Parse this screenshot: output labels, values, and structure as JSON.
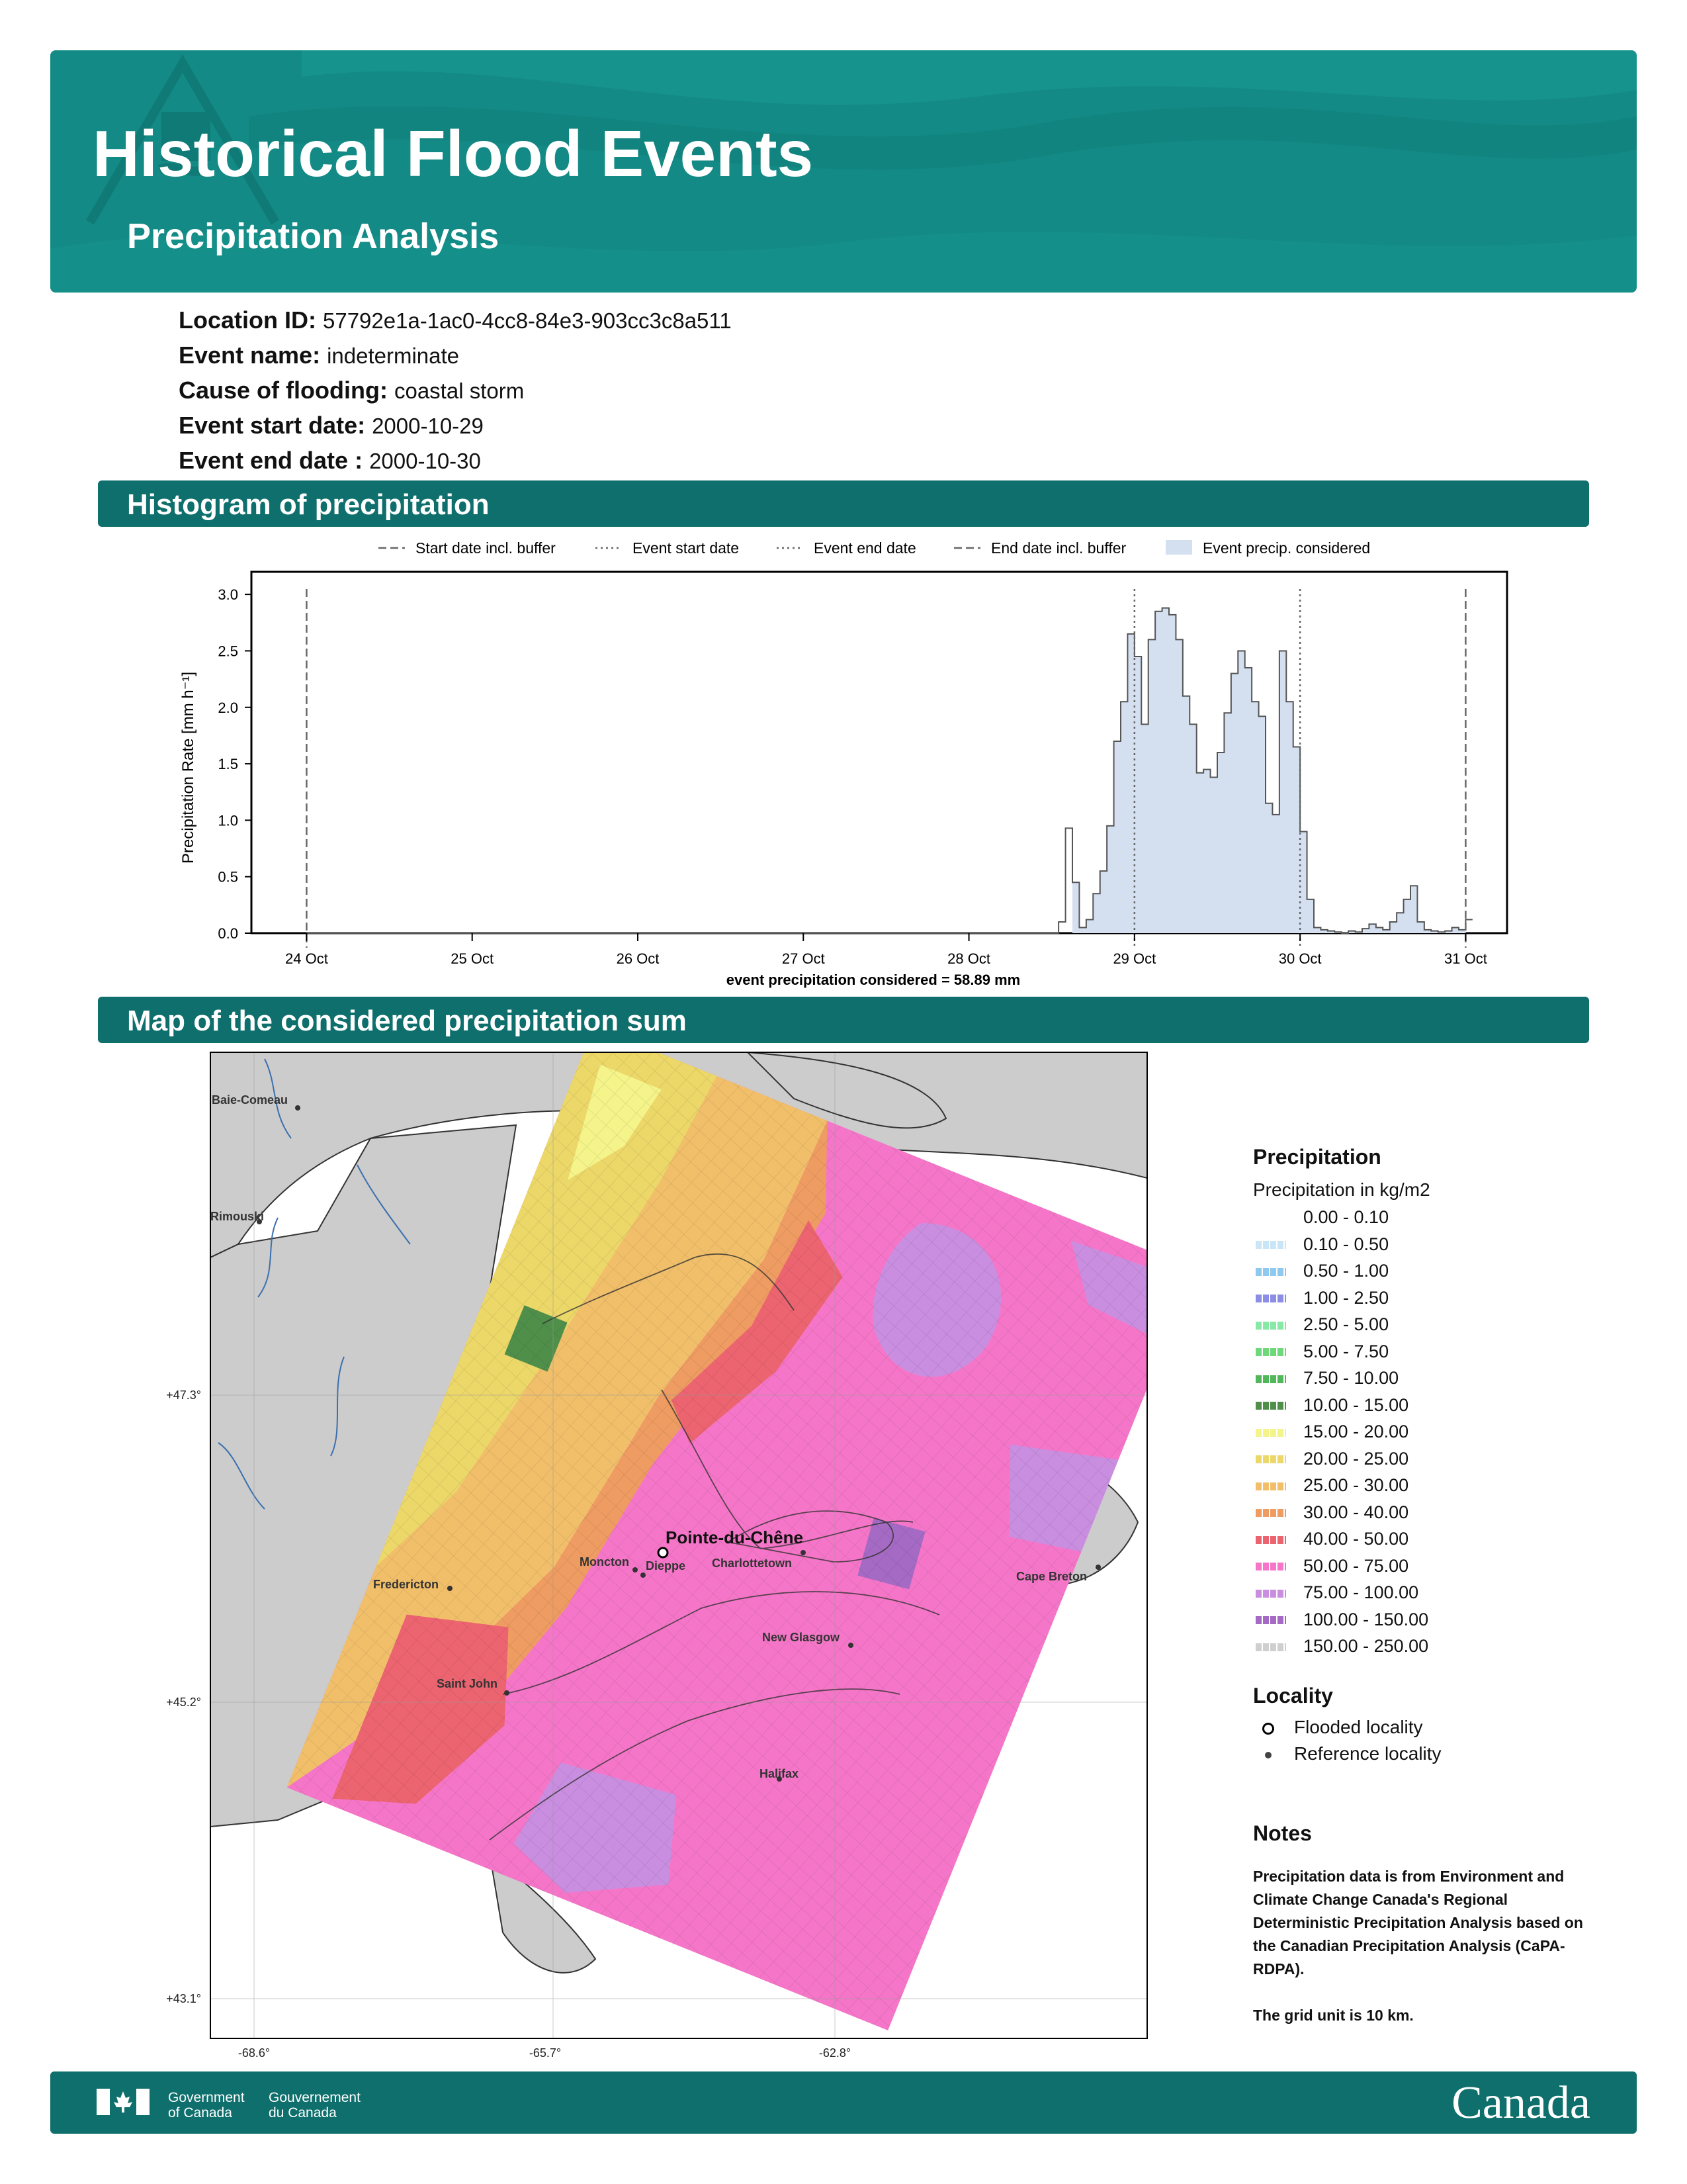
{
  "header": {
    "title": "Historical Flood Events",
    "subtitle": "Precipitation Analysis"
  },
  "meta": [
    {
      "label": "Location ID:",
      "value": "57792e1a-1ac0-4cc8-84e3-903cc3c8a511"
    },
    {
      "label": "Event name:",
      "value": "indeterminate"
    },
    {
      "label": "Cause of flooding:",
      "value": "coastal storm"
    },
    {
      "label": "Event start date:",
      "value": "2000-10-29"
    },
    {
      "label": "Event end date :",
      "value": "2000-10-30"
    }
  ],
  "sections": {
    "histogram": "Histogram of precipitation",
    "map": "Map of the considered precipitation sum"
  },
  "chart_data": {
    "type": "area",
    "ylabel": "Precipitation Rate [mm h⁻¹]",
    "xlabel": "event precipitation considered = 58.89 mm",
    "ylim": [
      0,
      3.2
    ],
    "xlim": [
      "2000-10-23T16:00",
      "2000-10-31T06:00"
    ],
    "x_ticks": [
      {
        "date": "2000-10-24",
        "label": "24 Oct"
      },
      {
        "date": "2000-10-25",
        "label": "25 Oct"
      },
      {
        "date": "2000-10-26",
        "label": "26 Oct"
      },
      {
        "date": "2000-10-27",
        "label": "27 Oct"
      },
      {
        "date": "2000-10-28",
        "label": "28 Oct"
      },
      {
        "date": "2000-10-29",
        "label": "29 Oct"
      },
      {
        "date": "2000-10-30",
        "label": "30 Oct"
      },
      {
        "date": "2000-10-31",
        "label": "31 Oct"
      }
    ],
    "y_ticks": [
      {
        "value": 0.0,
        "label": "0.0"
      },
      {
        "value": 0.5,
        "label": "0.5"
      },
      {
        "value": 1.0,
        "label": "1.0"
      },
      {
        "value": 1.5,
        "label": "1.5"
      },
      {
        "value": 2.0,
        "label": "2.0"
      },
      {
        "value": 2.5,
        "label": "2.5"
      },
      {
        "value": 3.0,
        "label": "3.0"
      }
    ],
    "legend": [
      {
        "label": "Start date incl. buffer",
        "style": "dashed"
      },
      {
        "label": "Event start date",
        "style": "dotted"
      },
      {
        "label": "Event end date",
        "style": "dotted"
      },
      {
        "label": "End date incl. buffer",
        "style": "dashed"
      },
      {
        "label": "Event precip. considered",
        "style": "fill"
      }
    ],
    "vlines": [
      {
        "date": "2000-10-24T00:00",
        "style": "dashed"
      },
      {
        "date": "2000-10-29T00:00",
        "style": "dotted"
      },
      {
        "date": "2000-10-30T00:00",
        "style": "dotted"
      },
      {
        "date": "2000-10-31T00:00",
        "style": "dashed"
      }
    ],
    "fill_range": [
      "2000-10-28T15:00",
      "2000-10-31T00:00"
    ],
    "series": [
      {
        "start": "2000-10-28T13:00",
        "step_hours": 1,
        "values": [
          0.1,
          0.93,
          0.45,
          0.05,
          0.12,
          0.35,
          0.55,
          0.95,
          1.7,
          2.05,
          2.65,
          2.45,
          1.85,
          2.6,
          2.85,
          2.88,
          2.82,
          2.6,
          2.1,
          1.85,
          1.42,
          1.45,
          1.38,
          1.6,
          1.95,
          2.3,
          2.5,
          2.35,
          2.05,
          1.92,
          1.15,
          1.05,
          2.5,
          2.05,
          1.65,
          0.9,
          0.3,
          0.05,
          0.03,
          0.02,
          0.01,
          0.0,
          0.02,
          0.01,
          0.04,
          0.08,
          0.05,
          0.03,
          0.1,
          0.18,
          0.3,
          0.42,
          0.1,
          0.03,
          0.02,
          0.01,
          0.02,
          0.05,
          0.03,
          0.12
        ]
      }
    ]
  },
  "map": {
    "lon_labels": [
      "-68.6°",
      "-65.7°",
      "-62.8°"
    ],
    "lat_labels": [
      "+47.3°",
      "+45.2°",
      "+43.1°"
    ],
    "flooded_locality": "Pointe-du-Chêne",
    "reference_localities": [
      "Baie-Comeau",
      "Rimouski",
      "Fredericton",
      "Moncton",
      "Dieppe",
      "Charlottetown",
      "Cape Breton",
      "New Glasgow",
      "Saint John",
      "Halifax"
    ]
  },
  "legend": {
    "title": "Precipitation",
    "subtitle": "Precipitation in kg/m2",
    "bins": [
      {
        "label": "0.00 - 0.10",
        "color": "#ffffff"
      },
      {
        "label": "0.10 - 0.50",
        "color": "#c9e6f6"
      },
      {
        "label": "0.50 - 1.00",
        "color": "#8fc9ef"
      },
      {
        "label": "1.00 - 2.50",
        "color": "#8c8ee6"
      },
      {
        "label": "2.50 - 5.00",
        "color": "#88e8a6"
      },
      {
        "label": "5.00 - 7.50",
        "color": "#6fd87a"
      },
      {
        "label": "7.50 - 10.00",
        "color": "#50b85b"
      },
      {
        "label": "10.00 - 15.00",
        "color": "#4f8f4a"
      },
      {
        "label": "15.00 - 20.00",
        "color": "#f4f48a"
      },
      {
        "label": "20.00 - 25.00",
        "color": "#ecd769"
      },
      {
        "label": "25.00 - 30.00",
        "color": "#f1bf6a"
      },
      {
        "label": "30.00 - 40.00",
        "color": "#ee9c62"
      },
      {
        "label": "40.00 - 50.00",
        "color": "#ec6470"
      },
      {
        "label": "50.00 - 75.00",
        "color": "#f576c8"
      },
      {
        "label": "75.00 - 100.00",
        "color": "#c98ee0"
      },
      {
        "label": "100.00 - 150.00",
        "color": "#a56ac4"
      },
      {
        "label": "150.00 - 250.00",
        "color": "#cfcfcf"
      }
    ],
    "locality_title": "Locality",
    "flooded_label": "Flooded locality",
    "reference_label": "Reference locality"
  },
  "notes": {
    "title": "Notes",
    "text1": "Precipitation data is from Environment and Climate Change Canada's Regional Deterministic Precipitation Analysis based on the Canadian Precipitation Analysis (CaPA-RDPA).",
    "text2": "The grid unit is 10 km."
  },
  "footer": {
    "gov_en_1": "Government",
    "gov_en_2": "of Canada",
    "gov_fr_1": "Gouvernement",
    "gov_fr_2": "du Canada",
    "wordmark": "Canada"
  },
  "colors": {
    "header_bg": "#138a85",
    "band_bg": "#0e6f6c",
    "fill": "#d4dff0"
  }
}
